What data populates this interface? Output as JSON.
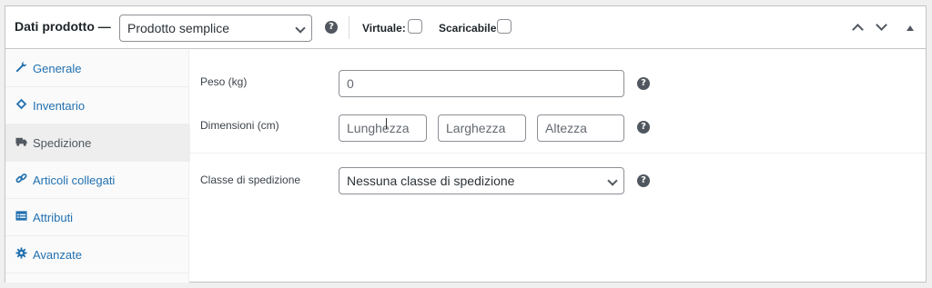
{
  "header": {
    "title": "Dati prodotto —",
    "product_type": "Prodotto semplice",
    "help_glyph": "?",
    "virtual_label": "Virtuale:",
    "downloadable_label": "Scaricabile:"
  },
  "sidebar": {
    "items": [
      {
        "label": "Generale",
        "icon": "wrench-icon",
        "active": false
      },
      {
        "label": "Inventario",
        "icon": "tag-icon",
        "active": false
      },
      {
        "label": "Spedizione",
        "icon": "truck-icon",
        "active": true
      },
      {
        "label": "Articoli collegati",
        "icon": "link-icon",
        "active": false
      },
      {
        "label": "Attributi",
        "icon": "list-view-icon",
        "active": false
      },
      {
        "label": "Avanzate",
        "icon": "gear-icon",
        "active": false
      }
    ]
  },
  "shipping": {
    "weight_label": "Peso (kg)",
    "weight_placeholder": "0",
    "dimensions_label": "Dimensioni (cm)",
    "length_placeholder": "Lunghezza",
    "width_placeholder": "Larghezza",
    "height_placeholder": "Altezza",
    "class_label": "Classe di spedizione",
    "class_value": "Nessuna classe di spedizione"
  },
  "colors": {
    "link": "#2271b1",
    "border": "#c3c4c7",
    "active_tab_bg": "#eeeeee"
  }
}
